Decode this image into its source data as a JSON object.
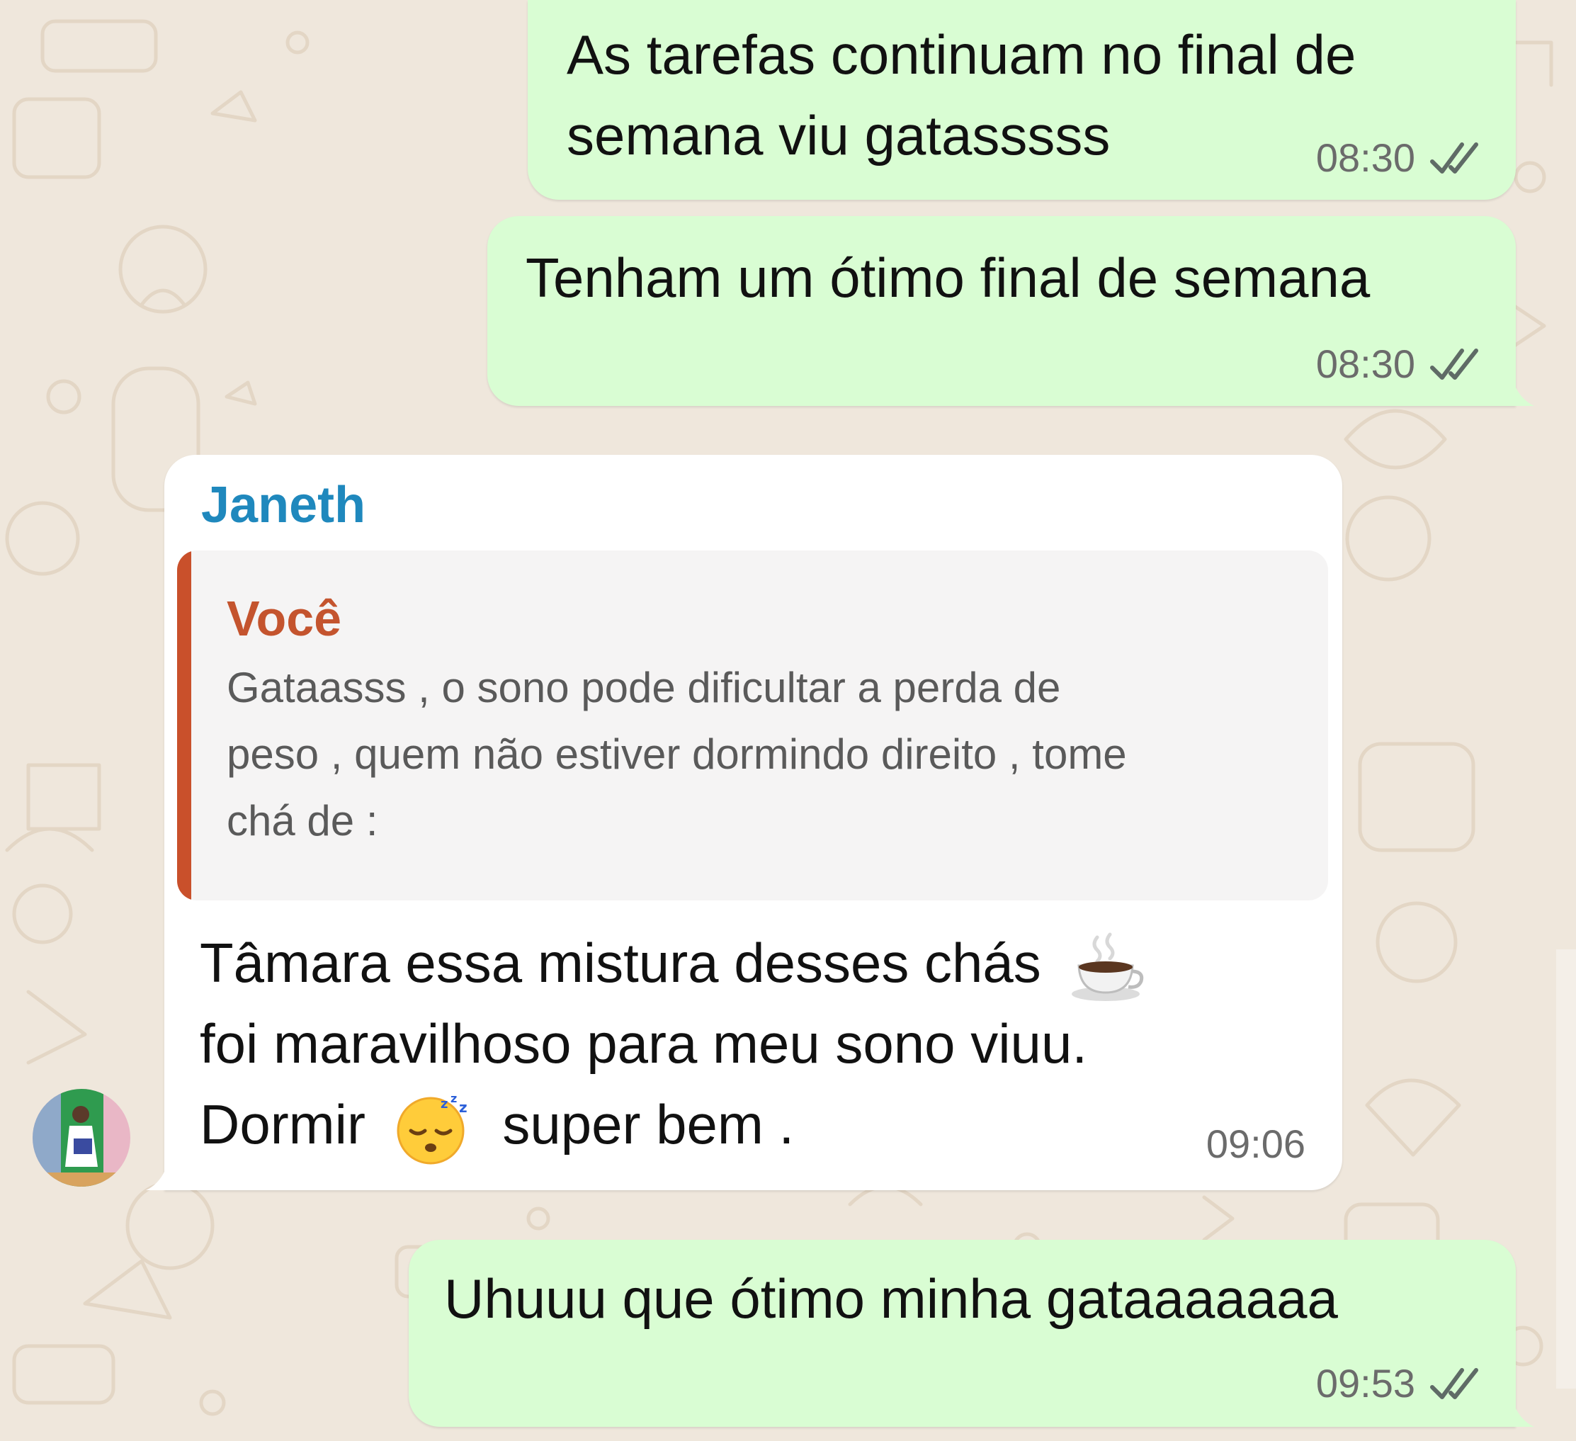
{
  "messages": [
    {
      "direction": "outgoing",
      "lines": [
        "As tarefas continuam no final de",
        "semana viu gatasssss"
      ],
      "time": "08:30",
      "status_icon": "double-check-icon"
    },
    {
      "direction": "outgoing",
      "lines": [
        "Tenham um ótimo final de semana"
      ],
      "time": "08:30",
      "status_icon": "double-check-icon"
    },
    {
      "direction": "incoming",
      "sender": "Janeth",
      "reply": {
        "author": "Você",
        "lines": [
          "Gataasss , o sono pode dificultar a perda de",
          "peso , quem não estiver dormindo direito , tome",
          "chá de :"
        ]
      },
      "lines": [
        "Tâmara  essa mistura desses  chás",
        "foi  maravilhoso para meu sono viuu.",
        "Dormir",
        "super bem ."
      ],
      "emojis": [
        "hot-beverage-icon",
        "sleeping-face-icon"
      ],
      "time": "09:06",
      "avatar_icon": "contact-avatar"
    },
    {
      "direction": "outgoing",
      "lines": [
        "Uhuuu que ótimo minha gataaaaaaa"
      ],
      "time": "09:53",
      "status_icon": "double-check-icon"
    }
  ],
  "colors": {
    "wallpaper": "#efe7dc",
    "outgoing_bubble": "#d9fdd3",
    "incoming_bubble": "#ffffff",
    "sender_name": "#1f88bd",
    "quote_author": "#c4542e",
    "quote_bar": "#c9502b",
    "read_ticks": "#5f6b66"
  }
}
